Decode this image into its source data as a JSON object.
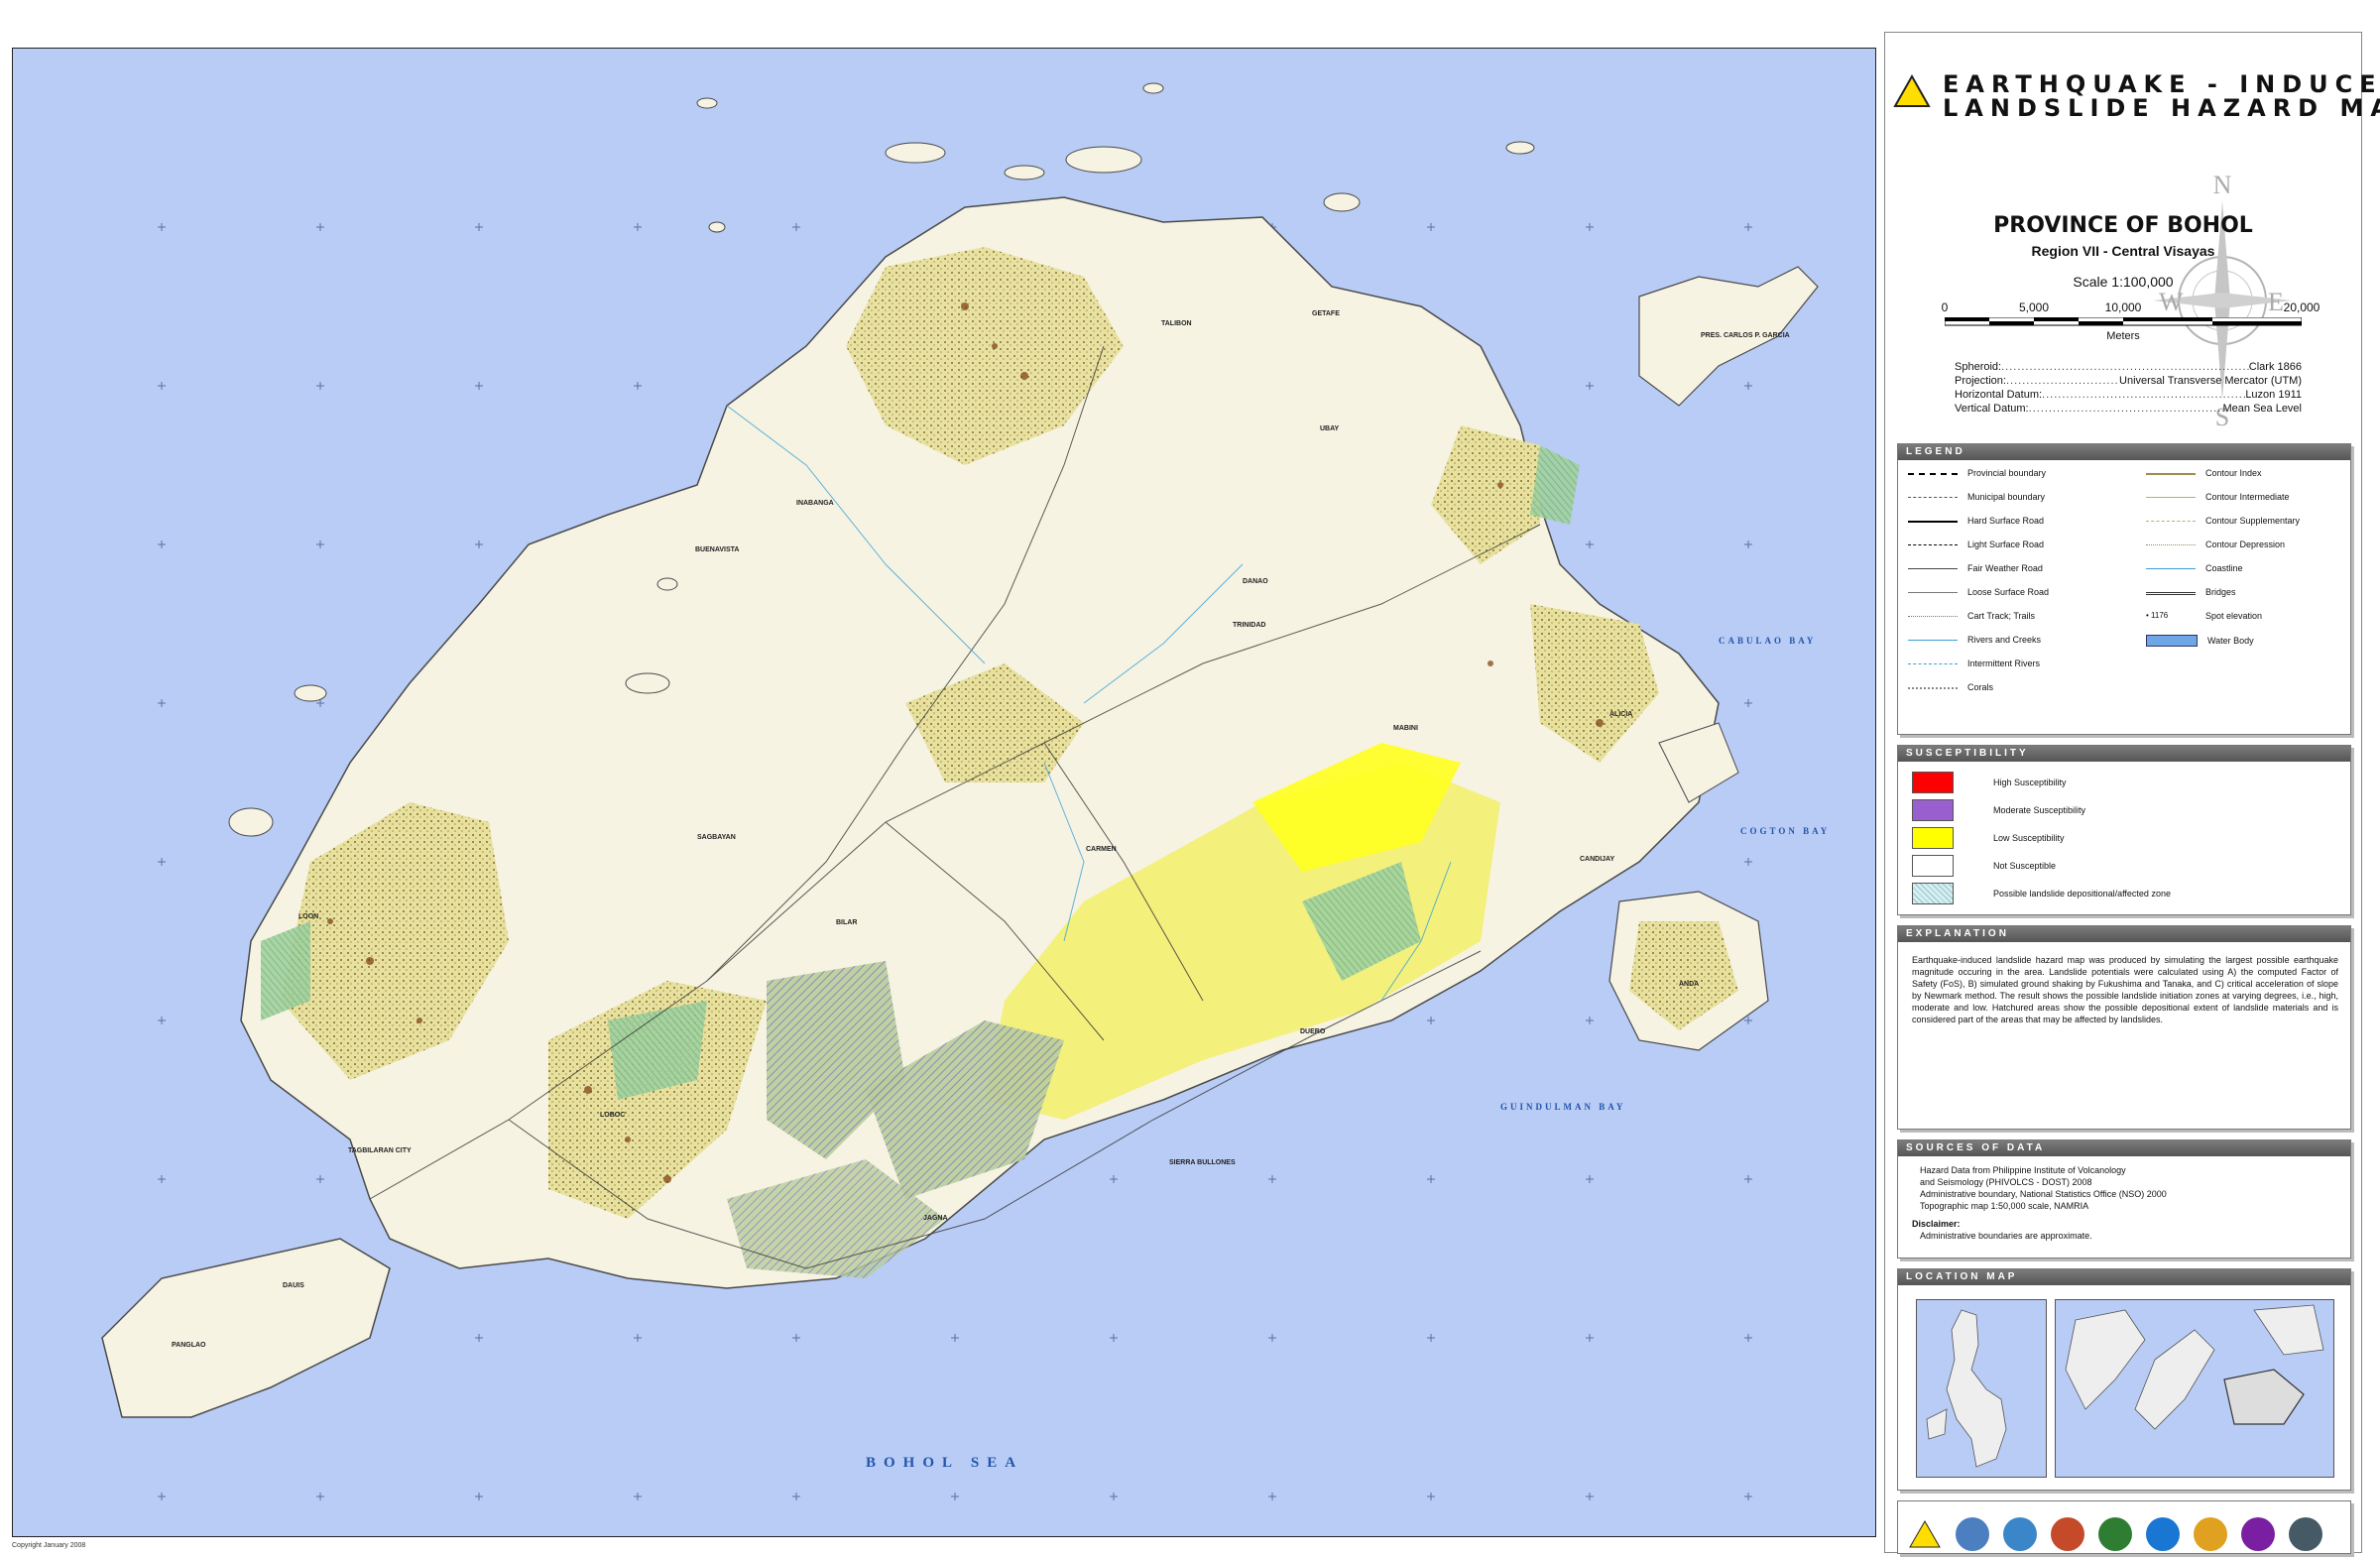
{
  "map": {
    "sea_labels": {
      "bohol_sea": "BOHOL SEA",
      "cabulao_bay": "CABULAO BAY",
      "cogton_bay": "COGTON BAY",
      "guindulman_bay": "GUINDULMAN BAY"
    },
    "islands": {
      "panglao": "PANGLAO",
      "dauis": "DAUIS",
      "pres_carlos_garcia": "PRES. CARLOS P. GARCIA",
      "tagbilaran": "TAGBILARAN CITY",
      "carmen": "CARMEN",
      "ubay": "UBAY",
      "talibon": "TALIBON",
      "inabanga": "INABANGA",
      "loon": "LOON",
      "jagna": "JAGNA",
      "candijay": "CANDIJAY",
      "alicia": "ALICIA",
      "buenavista": "BUENAVISTA",
      "sagbayan": "SAGBAYAN",
      "bilar": "BILAR",
      "loboc": "LOBOC",
      "danao": "DANAO",
      "trinidad": "TRINIDAD",
      "sierra_bullones": "SIERRA BULLONES",
      "mabini": "MABINI",
      "anda": "ANDA",
      "duero": "DUERO",
      "getafe": "GETAFE"
    },
    "copyright": "Copyright January 2008"
  },
  "panel": {
    "title_line1": "EARTHQUAKE - INDUCED",
    "title_line2": "LANDSLIDE  HAZARD MAP",
    "province": "PROVINCE OF BOHOL",
    "region": "Region VII - Central Visayas",
    "scale": "Scale 1:100,000",
    "scale_ticks": [
      "0",
      "5,000",
      "10,000",
      "20,000"
    ],
    "scale_unit": "Meters",
    "compass": {
      "n": "N",
      "s": "S",
      "e": "E",
      "w": "W"
    },
    "specs": [
      {
        "label": "Spheroid:",
        "value": "Clark 1866"
      },
      {
        "label": "Projection:",
        "value": "Universal Transverse Mercator (UTM)"
      },
      {
        "label": "Horizontal Datum:",
        "value": "Luzon 1911"
      },
      {
        "label": "Vertical Datum:",
        "value": "Mean Sea Level"
      }
    ],
    "legend": {
      "heading": "LEGEND",
      "left": [
        "Provincial boundary",
        "Municipal boundary",
        "Hard Surface Road",
        "Light Surface Road",
        "Fair Weather Road",
        "Loose Surface Road",
        "Cart Track; Trails",
        "Rivers and Creeks",
        "Intermittent Rivers",
        "Corals"
      ],
      "right": [
        "Contour Index",
        "Contour Intermediate",
        "Contour Supplementary",
        "Contour Depression",
        "Coastline",
        "Bridges",
        "Spot elevation",
        "Water Body"
      ],
      "spot_value": "1176"
    },
    "susceptibility": {
      "heading": "SUSCEPTIBILITY",
      "items": [
        {
          "label": "High Susceptibility",
          "color": "#ff0000"
        },
        {
          "label": "Moderate Susceptibility",
          "color": "#9a5fcf"
        },
        {
          "label": "Low Susceptibility",
          "color": "#ffff00"
        },
        {
          "label": "Not Susceptible",
          "color": "#ffffff"
        },
        {
          "label": "Possible landslide depositional/affected zone",
          "color": "hatch"
        }
      ]
    },
    "explanation": {
      "heading": "EXPLANATION",
      "text": "Earthquake-induced landslide hazard map was produced by simulating the largest possible earthquake magnitude occuring in the area. Landslide  potentials were calculated using A) the computed Factor of Safety  (FoS),  B)  simulated  ground  shaking  by  Fukushima  and  Tanaka,  and  C)  critical  acceleration  of slope by Newmark method.  The  result  shows  the possible landslide initiation zones at varying degrees, i.e.,  high,  moderate  and  low.  Hatchured  areas  show  the  possible  depositional  extent  of  landslide materials and is considered part of the areas that may be affected by landslides."
    },
    "sources": {
      "heading": "SOURCES OF DATA",
      "lines": [
        "Hazard Data from Philippine Institute of Volcanology",
        "and Seismology (PHIVOLCS - DOST) 2008",
        "Administrative boundary, National Statistics Office (NSO) 2000",
        "Topographic map 1:50,000 scale,  NAMRIA"
      ],
      "disclaimer_title": "Disclaimer:",
      "disclaimer": "Administrative boundaries are approximate."
    },
    "location_map": {
      "heading": "LOCATION MAP"
    }
  }
}
